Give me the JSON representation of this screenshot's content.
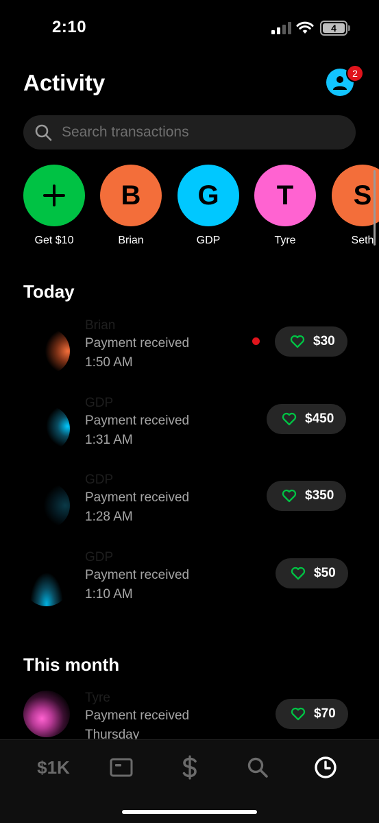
{
  "status_bar": {
    "time": "2:10",
    "battery": "4"
  },
  "header": {
    "title": "Activity",
    "notification_count": "2"
  },
  "search": {
    "placeholder": "Search transactions"
  },
  "contacts": [
    {
      "initial": "+",
      "name": "Get $10",
      "color": "#00c244"
    },
    {
      "initial": "B",
      "name": "Brian",
      "color": "#f36e3a"
    },
    {
      "initial": "G",
      "name": "GDP",
      "color": "#00c8ff"
    },
    {
      "initial": "T",
      "name": "Tyre",
      "color": "#ff63d1"
    },
    {
      "initial": "S",
      "name": "Seth",
      "color": "#f36e3a"
    }
  ],
  "sections": {
    "today": "Today",
    "this_month": "This month"
  },
  "transactions": [
    {
      "name": "Brian",
      "description": "Payment received",
      "time": "1:50 AM",
      "amount": "$30",
      "unread": true,
      "color": "#f36e3a"
    },
    {
      "name": "GDP",
      "description": "Payment received",
      "time": "1:31 AM",
      "amount": "$450",
      "unread": false,
      "color": "#00c8ff"
    },
    {
      "name": "GDP",
      "description": "Payment received",
      "time": "1:28 AM",
      "amount": "$350",
      "unread": false,
      "color": "#00c8ff"
    },
    {
      "name": "GDP",
      "description": "Payment received",
      "time": "1:10 AM",
      "amount": "$50",
      "unread": false,
      "color": "#00c8ff"
    },
    {
      "name": "Tyre",
      "description": "Payment received",
      "time": "Thursday",
      "amount": "$70",
      "unread": false,
      "color": "#ff63d1"
    }
  ],
  "bottom_nav": {
    "balance_label": "$1K",
    "items": [
      "balance",
      "card-icon",
      "dollar-icon",
      "search-icon",
      "activity-icon"
    ]
  },
  "colors": {
    "accent_green": "#00c244",
    "badge_red": "#e0141c",
    "avatar_blue": "#12c4ff"
  }
}
